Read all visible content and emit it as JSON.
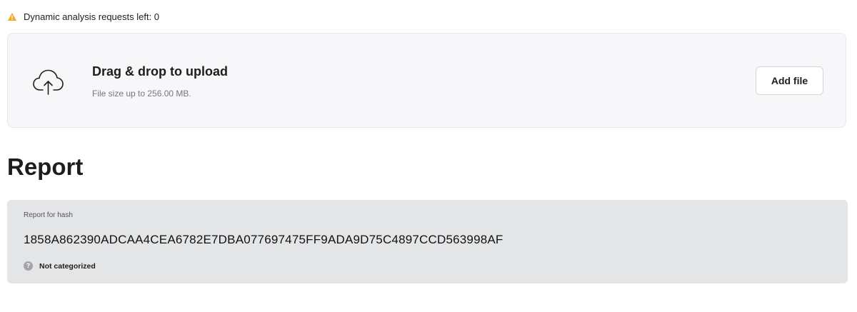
{
  "warning": {
    "text": "Dynamic analysis requests left: 0",
    "icon": "warning-triangle-icon",
    "color": "#f5a623"
  },
  "upload": {
    "icon": "cloud-upload-icon",
    "title": "Drag & drop to upload",
    "subtitle": "File size up to 256.00 MB.",
    "button_label": "Add file"
  },
  "report": {
    "heading": "Report",
    "label": "Report for hash",
    "hash": "1858A862390ADCAA4CEA6782E7DBA077697475FF9ADA9D75C4897CCD563998AF",
    "category": {
      "icon": "question-circle-icon",
      "icon_glyph": "?",
      "text": "Not categorized"
    }
  }
}
